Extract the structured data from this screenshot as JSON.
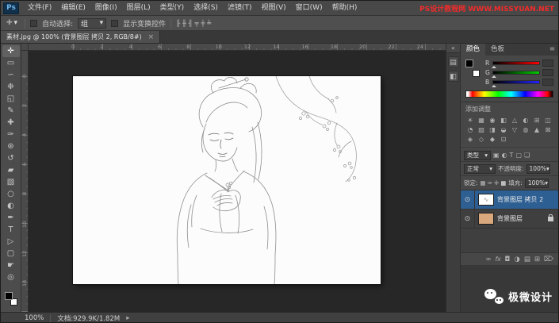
{
  "titlebar": {
    "logo": "Ps",
    "menus": [
      "文件(F)",
      "编辑(E)",
      "图像(I)",
      "图层(L)",
      "类型(Y)",
      "选择(S)",
      "滤镜(T)",
      "视图(V)",
      "窗口(W)",
      "帮助(H)"
    ],
    "watermark": "PS设计教程网 WWW.MISSYUAN.NET"
  },
  "ui": {
    "caret": "▾",
    "menu_icon": "≡"
  },
  "colors": {
    "selection_blue": "#2e5f93",
    "watermark_red": "#f32b2b",
    "background_layer_thumb": "#d9a87c"
  },
  "optionsbar": {
    "tool_icon": "✛",
    "auto_select_label": "自动选择:",
    "auto_select_value": "组",
    "show_transform_label": "显示变换控件",
    "align_icons": [
      "╟",
      "╫",
      "╢",
      "╤",
      "╪",
      "╧"
    ]
  },
  "tabbar": {
    "title": "素材.jpg @ 100% (背景图层 拷贝 2, RGB/8#)",
    "close": "×"
  },
  "toolbar": {
    "tools": {
      "move": "✛",
      "marquee": "▭",
      "lasso": "∽",
      "quick_select": "❉",
      "crop": "◱",
      "eyedropper": "✎",
      "healing": "✚",
      "brush": "✑",
      "stamp": "⊛",
      "history_brush": "↺",
      "eraser": "▰",
      "gradient": "▧",
      "blur": "○",
      "dodge": "◐",
      "pen": "✒",
      "type": "T",
      "path_select": "▷",
      "shape": "▢",
      "hand": "☛",
      "zoom": "◎"
    }
  },
  "rulers": {
    "h": [
      "0",
      "2",
      "4",
      "6",
      "8",
      "10",
      "12",
      "14",
      "16",
      "18",
      "20",
      "22",
      "24"
    ],
    "v": [
      "0",
      "2",
      "4",
      "6",
      "8",
      "10",
      "12",
      "14"
    ]
  },
  "dock": {
    "collapse": "«",
    "icons": [
      "▤",
      "◧"
    ]
  },
  "panels": {
    "color": {
      "tabs": [
        "颜色",
        "色板"
      ],
      "channels": [
        {
          "label": "R"
        },
        {
          "label": "G"
        },
        {
          "label": "B"
        }
      ]
    },
    "adjustments": {
      "title": "添加调整",
      "icons": [
        "☀",
        "▦",
        "◉",
        "◧",
        "△",
        "◐",
        "⊞",
        "◫",
        "◔",
        "▨",
        "◨",
        "◒",
        "▽",
        "◍",
        "▲",
        "⊠",
        "◈",
        "◇",
        "◆",
        "⊡"
      ]
    },
    "layers": {
      "filter_label": "类型",
      "filter_icons": [
        "▣",
        "◐",
        "T",
        "▢",
        "❏"
      ],
      "blend_mode": "正常",
      "opacity_label": "不透明度:",
      "opacity_value": "100%",
      "lock_label": "锁定:",
      "lock_icons": [
        "▦",
        "✑",
        "✛",
        "■"
      ],
      "fill_label": "填充:",
      "fill_value": "100%",
      "eye_icon": "⊙",
      "thumb_glyph": "∿",
      "rows": [
        {
          "name": "背景图层 拷贝 2",
          "selected": true
        },
        {
          "name": "背景图层",
          "selected": false,
          "locked": true
        }
      ],
      "bottom": {
        "link": "∞",
        "fx": "fx",
        "mask": "◘",
        "adjust": "◑",
        "group": "▤",
        "new": "⊞",
        "trash": "⌦"
      }
    }
  },
  "statusbar": {
    "zoom": "100%",
    "doc_info": "文档:929.9K/1.82M",
    "arrow": "▸"
  },
  "brand": {
    "text": "极微设计"
  }
}
